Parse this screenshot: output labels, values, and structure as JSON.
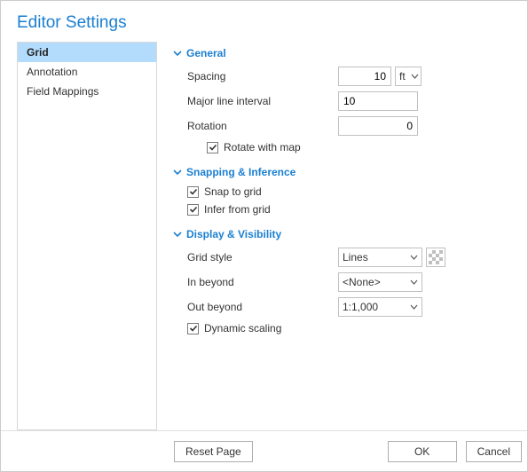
{
  "title": "Editor Settings",
  "sidebar": {
    "items": [
      {
        "label": "Grid",
        "selected": true
      },
      {
        "label": "Annotation",
        "selected": false
      },
      {
        "label": "Field Mappings",
        "selected": false
      }
    ]
  },
  "sections": {
    "general": {
      "title": "General",
      "spacing": {
        "label": "Spacing",
        "value": "10",
        "unit": "ft"
      },
      "major_interval": {
        "label": "Major line interval",
        "value": "10"
      },
      "rotation": {
        "label": "Rotation",
        "value": "0"
      },
      "rotate_with_map": {
        "label": "Rotate with map",
        "checked": true
      }
    },
    "snapping": {
      "title": "Snapping & Inference",
      "snap_to_grid": {
        "label": "Snap to grid",
        "checked": true
      },
      "infer_from_grid": {
        "label": "Infer from grid",
        "checked": true
      }
    },
    "display": {
      "title": "Display & Visibility",
      "grid_style": {
        "label": "Grid style",
        "value": "Lines"
      },
      "in_beyond": {
        "label": "In beyond",
        "value": "<None>"
      },
      "out_beyond": {
        "label": "Out beyond",
        "value": "1:1,000"
      },
      "dynamic_scaling": {
        "label": "Dynamic scaling",
        "checked": true
      }
    }
  },
  "footer": {
    "reset": "Reset Page",
    "ok": "OK",
    "cancel": "Cancel"
  }
}
